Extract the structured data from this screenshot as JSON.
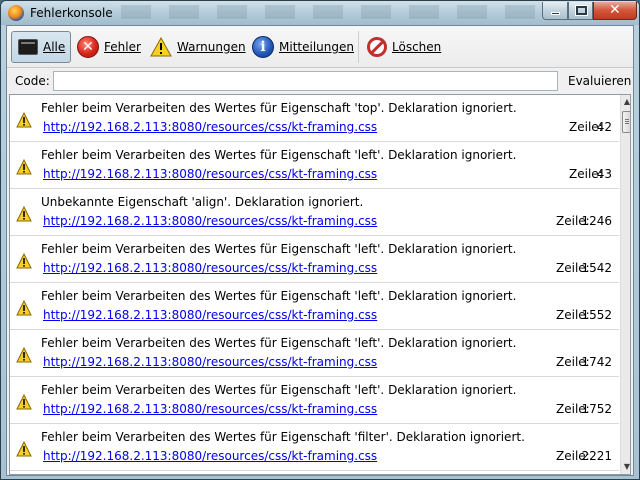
{
  "window": {
    "title": "Fehlerkonsole"
  },
  "toolbar": {
    "all": "Alle",
    "errors": "Fehler",
    "warnings": "Warnungen",
    "messages": "Mitteilungen",
    "clear": "Löschen"
  },
  "code": {
    "label": "Code:",
    "value": "",
    "evaluate": "Evaluieren"
  },
  "line_label": "Zeile:",
  "entries": [
    {
      "message": "Fehler beim Verarbeiten des Wertes für Eigenschaft 'top'.  Deklaration ignoriert.",
      "source": "http://192.168.2.113:8080/resources/css/kt-framing.css",
      "line": "42"
    },
    {
      "message": "Fehler beim Verarbeiten des Wertes für Eigenschaft 'left'.  Deklaration ignoriert.",
      "source": "http://192.168.2.113:8080/resources/css/kt-framing.css",
      "line": "43"
    },
    {
      "message": "Unbekannte Eigenschaft 'align'.  Deklaration ignoriert.",
      "source": "http://192.168.2.113:8080/resources/css/kt-framing.css",
      "line": "1246"
    },
    {
      "message": "Fehler beim Verarbeiten des Wertes für Eigenschaft 'left'.  Deklaration ignoriert.",
      "source": "http://192.168.2.113:8080/resources/css/kt-framing.css",
      "line": "1542"
    },
    {
      "message": "Fehler beim Verarbeiten des Wertes für Eigenschaft 'left'.  Deklaration ignoriert.",
      "source": "http://192.168.2.113:8080/resources/css/kt-framing.css",
      "line": "1552"
    },
    {
      "message": "Fehler beim Verarbeiten des Wertes für Eigenschaft 'left'.  Deklaration ignoriert.",
      "source": "http://192.168.2.113:8080/resources/css/kt-framing.css",
      "line": "1742"
    },
    {
      "message": "Fehler beim Verarbeiten des Wertes für Eigenschaft 'left'.  Deklaration ignoriert.",
      "source": "http://192.168.2.113:8080/resources/css/kt-framing.css",
      "line": "1752"
    },
    {
      "message": "Fehler beim Verarbeiten des Wertes für Eigenschaft 'filter'.  Deklaration ignoriert.",
      "source": "http://192.168.2.113:8080/resources/css/kt-framing.css",
      "line": "2221"
    }
  ],
  "icons": {
    "app": "firefox-icon",
    "all": "console-icon",
    "errors": "error-icon",
    "warnings": "warning-icon",
    "messages": "info-icon",
    "clear": "clear-icon",
    "entry": "warning-icon"
  },
  "colors": {
    "link": "#0000ee",
    "error": "#d8261a",
    "warning": "#f2c200",
    "info": "#2054b8"
  }
}
